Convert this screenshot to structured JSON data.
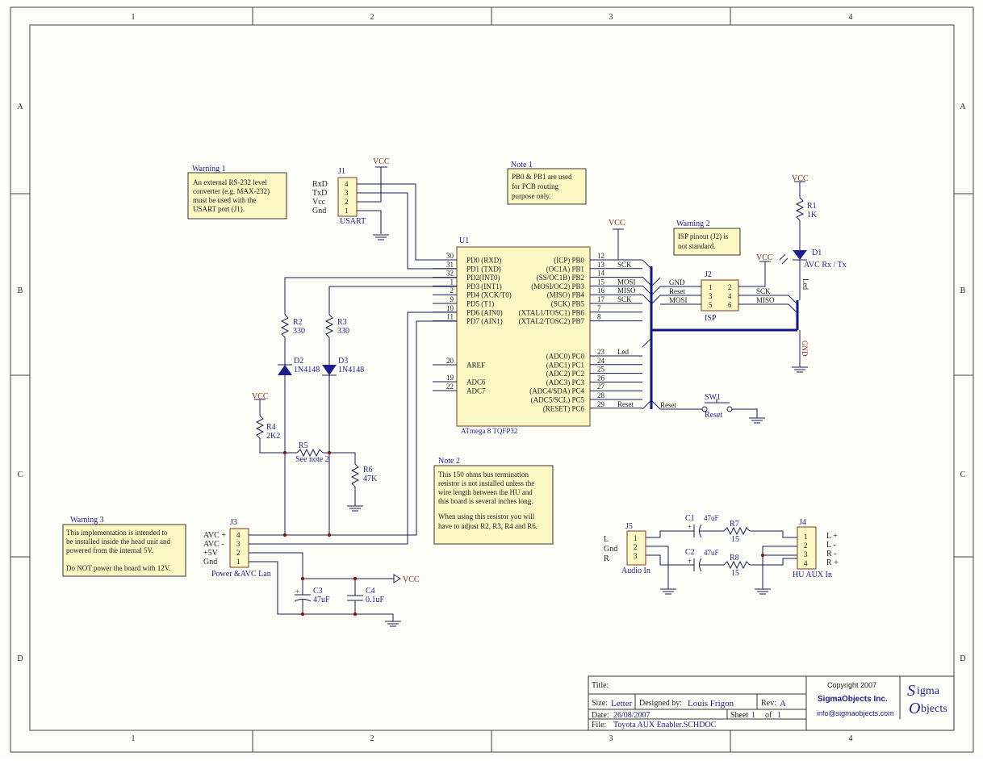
{
  "border": {
    "columns": [
      "1",
      "2",
      "3",
      "4"
    ],
    "rows": [
      "A",
      "B",
      "C",
      "D"
    ]
  },
  "power_labels": {
    "vcc": "VCC",
    "gnd": "GND"
  },
  "notes": {
    "warning1": {
      "title": "Warning 1",
      "lines": [
        "An external RS-232 level",
        "converter (e.g. MAX-232)",
        "must be used with the",
        "USART port (J1)."
      ]
    },
    "note1": {
      "title": "Note 1",
      "lines": [
        "PB0 & PB1 are used",
        "for PCB routing",
        "purpose only."
      ]
    },
    "warning2": {
      "title": "Warning 2",
      "lines": [
        "ISP pinout (J2) is",
        "not standard."
      ]
    },
    "note2": {
      "title": "Note 2",
      "lines": [
        "This 150 ohms bus termination",
        "resistor is not installed unless the",
        "wire length between the HU and",
        "this board is several inches long.",
        "",
        "When using this resistor you will",
        "have to adjust R2, R3, R4 and R6."
      ]
    },
    "warning3": {
      "title": "Warning 3",
      "lines": [
        "This implementation is intended to",
        "be installed inside the head unit and",
        "powered from the internal 5V.",
        "",
        "Do NOT power the board with 12V."
      ]
    }
  },
  "j1": {
    "ref": "J1",
    "name": "USART",
    "pins": [
      "4",
      "3",
      "2",
      "1"
    ],
    "signals": [
      "RxD",
      "TxD",
      "Vcc",
      "Gnd"
    ]
  },
  "u1": {
    "ref": "U1",
    "part": "ATmega 8 TQFP32",
    "left_pins": [
      {
        "num": "30",
        "name": "PD0 (RXD)"
      },
      {
        "num": "31",
        "name": "PD1 (TXD)"
      },
      {
        "num": "32",
        "name": "PD2(INT0)"
      },
      {
        "num": "1",
        "name": "PD3 (INT1)"
      },
      {
        "num": "2",
        "name": "PD4 (XCK/T0)"
      },
      {
        "num": "9",
        "name": "PD5 (T1)"
      },
      {
        "num": "10",
        "name": "PD6 (AIN0)"
      },
      {
        "num": "11",
        "name": "PD7 (AIN1)"
      }
    ],
    "left_pins2": [
      {
        "num": "20",
        "name": "AREF"
      },
      {
        "num": "19",
        "name": "ADC6"
      },
      {
        "num": "22",
        "name": "ADC7"
      }
    ],
    "right_pins": [
      {
        "num": "12",
        "name": "(ICP) PB0",
        "net": ""
      },
      {
        "num": "13",
        "name": "(OC1A) PB1",
        "net": "SCK"
      },
      {
        "num": "14",
        "name": "(SS/OC1B) PB2",
        "net": ""
      },
      {
        "num": "15",
        "name": "(MOSI/OC2) PB3",
        "net": "MOSI"
      },
      {
        "num": "16",
        "name": "(MISO) PB4",
        "net": "MISO"
      },
      {
        "num": "17",
        "name": "(SCK) PB5",
        "net": "SCK"
      },
      {
        "num": "7",
        "name": "(XTAL1/TOSC1) PB6",
        "net": ""
      },
      {
        "num": "8",
        "name": "(XTAL2/TOSC2) PB7",
        "net": ""
      }
    ],
    "right_pins2": [
      {
        "num": "23",
        "name": "(ADC0) PC0",
        "net": "Led"
      },
      {
        "num": "24",
        "name": "(ADC1) PC1",
        "net": ""
      },
      {
        "num": "25",
        "name": "(ADC2) PC2",
        "net": ""
      },
      {
        "num": "26",
        "name": "(ADC3) PC3",
        "net": ""
      },
      {
        "num": "27",
        "name": "(ADC4/SDA) PC4",
        "net": ""
      },
      {
        "num": "28",
        "name": "(ADC5/SCL) PC5",
        "net": ""
      },
      {
        "num": "29",
        "name": "(RESET) PC6",
        "net": "Reset"
      }
    ]
  },
  "j2": {
    "ref": "J2",
    "name": "ISP",
    "pins_left": [
      "1",
      "3",
      "5"
    ],
    "pins_right": [
      "2",
      "4",
      "6"
    ],
    "nets_left": [
      "GND",
      "Reset",
      "MOSI"
    ],
    "nets_right": [
      "SCK",
      "MISO"
    ]
  },
  "r1": {
    "ref": "R1",
    "value": "1K"
  },
  "d1": {
    "ref": "D1",
    "value": "AVC Rx / Tx",
    "net": "Led"
  },
  "r2": {
    "ref": "R2",
    "value": "330"
  },
  "r3": {
    "ref": "R3",
    "value": "330"
  },
  "d2": {
    "ref": "D2",
    "value": "1N4148"
  },
  "d3": {
    "ref": "D3",
    "value": "1N4148"
  },
  "r4": {
    "ref": "R4",
    "value": "2K2"
  },
  "r5": {
    "ref": "R5",
    "value": "See note 2"
  },
  "r6": {
    "ref": "R6",
    "value": "47K"
  },
  "sw1": {
    "ref": "SW1",
    "value": "Reset",
    "net": "Reset"
  },
  "j3": {
    "ref": "J3",
    "name": "Power &AVC Lan",
    "pins": [
      "4",
      "3",
      "2",
      "1"
    ],
    "signals": [
      "AVC +",
      "AVC -",
      "+5V",
      "Gnd"
    ]
  },
  "c3": {
    "ref": "C3",
    "value": "47uF"
  },
  "c4": {
    "ref": "C4",
    "value": "0.1uF"
  },
  "j5": {
    "ref": "J5",
    "name": "Audio In",
    "pins": [
      "1",
      "2",
      "3"
    ],
    "signals": [
      "L",
      "Gnd",
      "R"
    ]
  },
  "c1": {
    "ref": "C1",
    "value": "47uF"
  },
  "c2": {
    "ref": "C2",
    "value": "47uF"
  },
  "r7": {
    "ref": "R7",
    "value": "15"
  },
  "r8": {
    "ref": "R8",
    "value": "15"
  },
  "j4": {
    "ref": "J4",
    "name": "HU AUX In",
    "pins": [
      "1",
      "2",
      "3",
      "4"
    ],
    "signals": [
      "L +",
      "L -",
      "R -",
      "R +"
    ]
  },
  "title_block": {
    "title_label": "Title:",
    "size_label": "Size:",
    "size": "Letter",
    "designed_label": "Designed by:",
    "designer": "Louis Frigon",
    "rev_label": "Rev:",
    "rev": "A",
    "date_label": "Date:",
    "date": "26/08/2007",
    "sheet_label": "Sheet",
    "sheet": "1",
    "of_label": "of",
    "sheets": "1",
    "file_label": "File:",
    "file": "Toyota AUX Enabler.SCHDOC",
    "copyright": "Copyright 2007",
    "company": "SigmaObjects Inc.",
    "email": "info@sigmaobjects.com",
    "logo_text": "Sigma Objects"
  }
}
